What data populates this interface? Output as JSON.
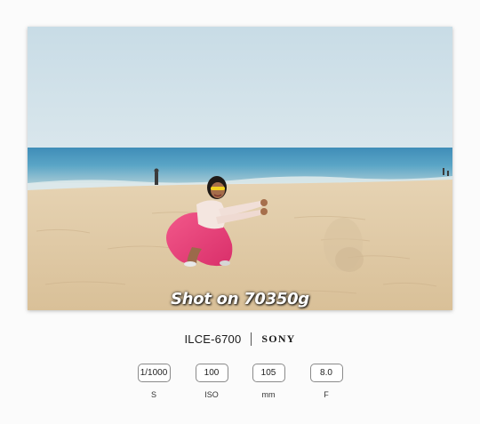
{
  "photo": {
    "watermark": "Shot on 70350g"
  },
  "camera": {
    "model": "ILCE-6700",
    "brand": "SONY"
  },
  "params": [
    {
      "value": "1/1000",
      "unit": "S"
    },
    {
      "value": "100",
      "unit": "ISO"
    },
    {
      "value": "105",
      "unit": "mm"
    },
    {
      "value": "8.0",
      "unit": "F"
    }
  ]
}
